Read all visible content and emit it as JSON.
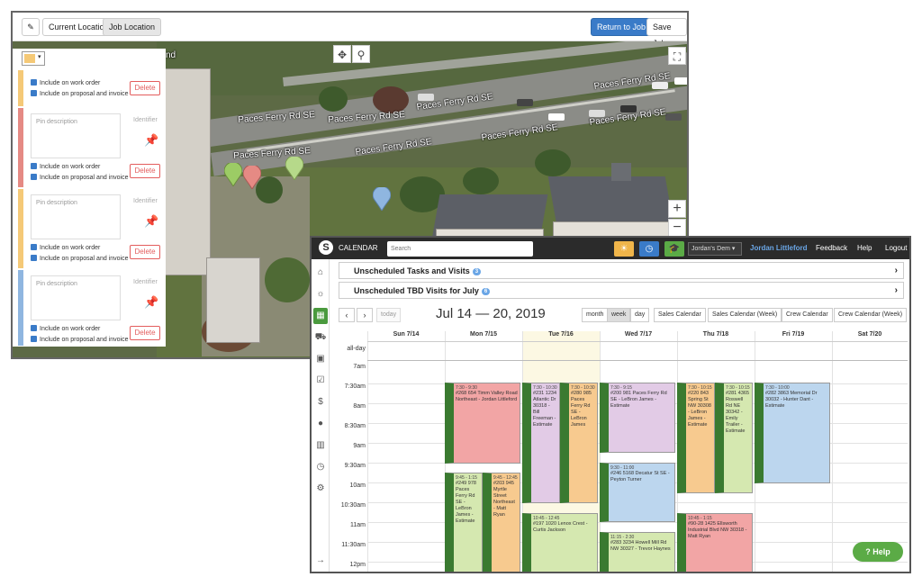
{
  "map_app": {
    "toolbar": {
      "current_location": "Current Location",
      "job_location": "Job Location",
      "return_to_job": "Return to Job",
      "save_job": "Save Job"
    },
    "street_labels": [
      "Paces Ferry Rd SE",
      "Paces Ferry Rd SE",
      "Paces Ferry Rd SE",
      "Paces Ferry Rd SE",
      "Paces Ferry Rd SE",
      "Paces Ferry Rd SE",
      "Paces Ferry Rd SE",
      "Paces Ferry Rd SE"
    ],
    "fragment_label": "nd",
    "pin_panel": {
      "pin_color": "#f5c977",
      "cards": [
        {
          "desc_placeholder": "",
          "identifier": "",
          "include_work_order": "Include on work order",
          "include_proposal": "Include on proposal and invoice",
          "delete": "Delete",
          "accent": "#f5c977"
        },
        {
          "desc_placeholder": "Pin description",
          "identifier": "Identifier",
          "include_work_order": "Include on work order",
          "include_proposal": "Include on proposal and invoice",
          "delete": "Delete",
          "accent": "#e58a84"
        },
        {
          "desc_placeholder": "Pin description",
          "identifier": "Identifier",
          "include_work_order": "Include on work order",
          "include_proposal": "Include on proposal and invoice",
          "delete": "Delete",
          "accent": "#f5c977"
        },
        {
          "desc_placeholder": "Pin description",
          "identifier": "Identifier",
          "include_work_order": "Include on work order",
          "include_proposal": "Include on proposal and invoice",
          "delete": "Delete",
          "accent": "#8fb6e0"
        }
      ]
    }
  },
  "calendar_app": {
    "title": "CALENDAR",
    "search_placeholder": "Search",
    "user_select": "Jordan's Dem",
    "user_name": "Jordan Littleford",
    "links": {
      "feedback": "Feedback",
      "help": "Help",
      "logout": "Logout"
    },
    "unscheduled_tasks": {
      "label": "Unscheduled Tasks and Visits",
      "count": "3"
    },
    "unscheduled_tbd": {
      "label": "Unscheduled TBD Visits for July",
      "count": "6"
    },
    "today": "today",
    "date_range": "Jul 14 — 20, 2019",
    "views": {
      "month": "month",
      "week": "week",
      "day": "day",
      "sales": "Sales Calendar",
      "sales_week": "Sales Calendar (Week)",
      "crew": "Crew Calendar",
      "crew_week": "Crew Calendar (Week)"
    },
    "days": [
      "Sun 7/14",
      "Mon 7/15",
      "Tue 7/16",
      "Wed 7/17",
      "Thu 7/18",
      "Fri 7/19",
      "Sat 7/20"
    ],
    "times": [
      "all-day",
      "7am",
      "7:30am",
      "8am",
      "8:30am",
      "9am",
      "9:30am",
      "10am",
      "10:30am",
      "11am",
      "11:30am",
      "12pm"
    ],
    "events": [
      {
        "time": "7:30 - 9:30",
        "text": "#268 654 Timm Valley Road Northeast - Jordan Littleford"
      },
      {
        "time": "9:45 - 1:15",
        "text": "#249 978 Paces Ferry Rd SE - LeBron James - Estimate"
      },
      {
        "time": "9:45 - 12:45",
        "text": "#203 945 Myrtle Street Northeast - Matt Ryan"
      },
      {
        "time": "7:30 - 10:30",
        "text": "#231 1234 Atlantic Dr 30318 - Bill Freeman - Estimate"
      },
      {
        "time": "7:30 - 10:30",
        "text": "#280 985 Paces Ferry Rd SE - LeBron James"
      },
      {
        "time": "10:45 - 12:45",
        "text": "#197 1020 Lenox Crest - Curtis Jackson"
      },
      {
        "time": "7:30 - 9:15",
        "text": "#200 981 Paces Ferry Rd SE - LeBron James - Estimate"
      },
      {
        "time": "9:30 - 11:00",
        "text": "#246 5168 Decatur St SE - Peyton Turner"
      },
      {
        "time": "11:15 - 2:30",
        "text": "#283 3234 Howell Mill Rd NW 30327 - Trevor Haynes"
      },
      {
        "time": "7:30 - 10:15",
        "text": "#220 843 Spring St NW 30308 - LeBron James - Estimate"
      },
      {
        "time": "7:30 - 10:15",
        "text": "#281 4365 Roswell Rd NE 30342 - Emily Trailer - Estimate"
      },
      {
        "time": "10:45 - 1:15",
        "text": "#90-28 1425 Ellsworth Industrial Blvd NW 30318 - Matt Ryan"
      },
      {
        "time": "7:30 - 10:00",
        "text": "#282 3863 Memorial Dr 30032 - Hunter Dant - Estimate"
      }
    ],
    "help_button": "Help"
  }
}
